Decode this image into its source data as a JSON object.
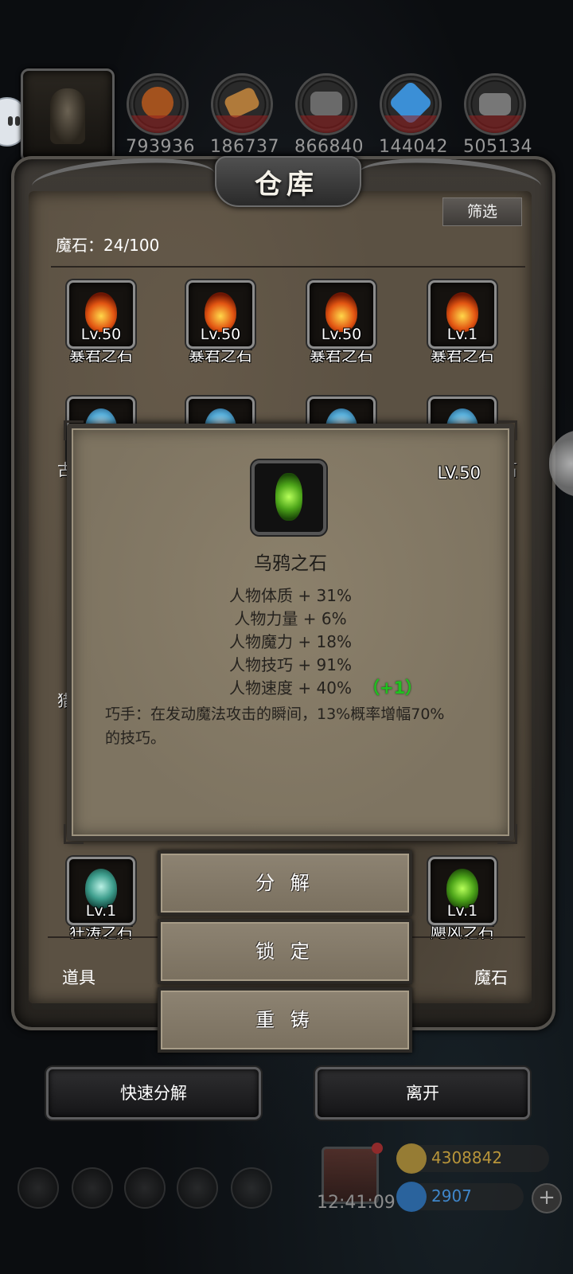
{
  "resources": [
    {
      "icon": "meat-icon",
      "amount": "793936",
      "color": "#a3521e"
    },
    {
      "icon": "wood-icon",
      "amount": "186737",
      "color": "#b07a3a"
    },
    {
      "icon": "iron-icon",
      "amount": "866840",
      "color": "#6a6a6a"
    },
    {
      "icon": "crystal-icon",
      "amount": "144042",
      "color": "#3b8fd6"
    },
    {
      "icon": "ingot-icon",
      "amount": "505134",
      "color": "#777777"
    }
  ],
  "panel": {
    "title": "仓库",
    "filter_label": "筛选",
    "capacity": "魔石：24/100"
  },
  "items": [
    {
      "level": "Lv.50",
      "name": "暴君之石",
      "gem": "fire"
    },
    {
      "level": "Lv.50",
      "name": "暴君之石",
      "gem": "fire"
    },
    {
      "level": "Lv.50",
      "name": "暴君之石",
      "gem": "fire"
    },
    {
      "level": "Lv.1",
      "name": "暴君之石",
      "gem": "fire"
    },
    {
      "level": "Lv.1",
      "name": "狂涛之石",
      "gem": "teal"
    },
    {
      "level": "Lv.1",
      "name": "飓风之石",
      "gem": "green"
    }
  ],
  "partial_labels": {
    "left_row2": "古",
    "right_row2": "石",
    "left_row4": "猎"
  },
  "tooltip": {
    "level": "LV.50",
    "name": "乌鸦之石",
    "stats": [
      {
        "text": "人物体质 + 31%",
        "bonus": ""
      },
      {
        "text": "人物力量 + 6%",
        "bonus": ""
      },
      {
        "text": "人物魔力 + 18%",
        "bonus": ""
      },
      {
        "text": "人物技巧 + 91%",
        "bonus": ""
      },
      {
        "text": "人物速度 + 40%",
        "bonus": "（+1）"
      }
    ],
    "skill": "巧手：在发动魔法攻击的瞬间，13%概率增幅70%的技巧。"
  },
  "actions": {
    "decompose": "分 解",
    "lock": "锁 定",
    "reforge": "重 铸"
  },
  "categories": {
    "left": "道具",
    "right": "魔石"
  },
  "footer": {
    "quick_decompose": "快速分解",
    "leave": "离开"
  },
  "hud": {
    "clock": "12:41:09",
    "gold": "4308842",
    "gems": "2907",
    "gold_color": "#c9a23a",
    "gem_color": "#2f7fd0"
  }
}
